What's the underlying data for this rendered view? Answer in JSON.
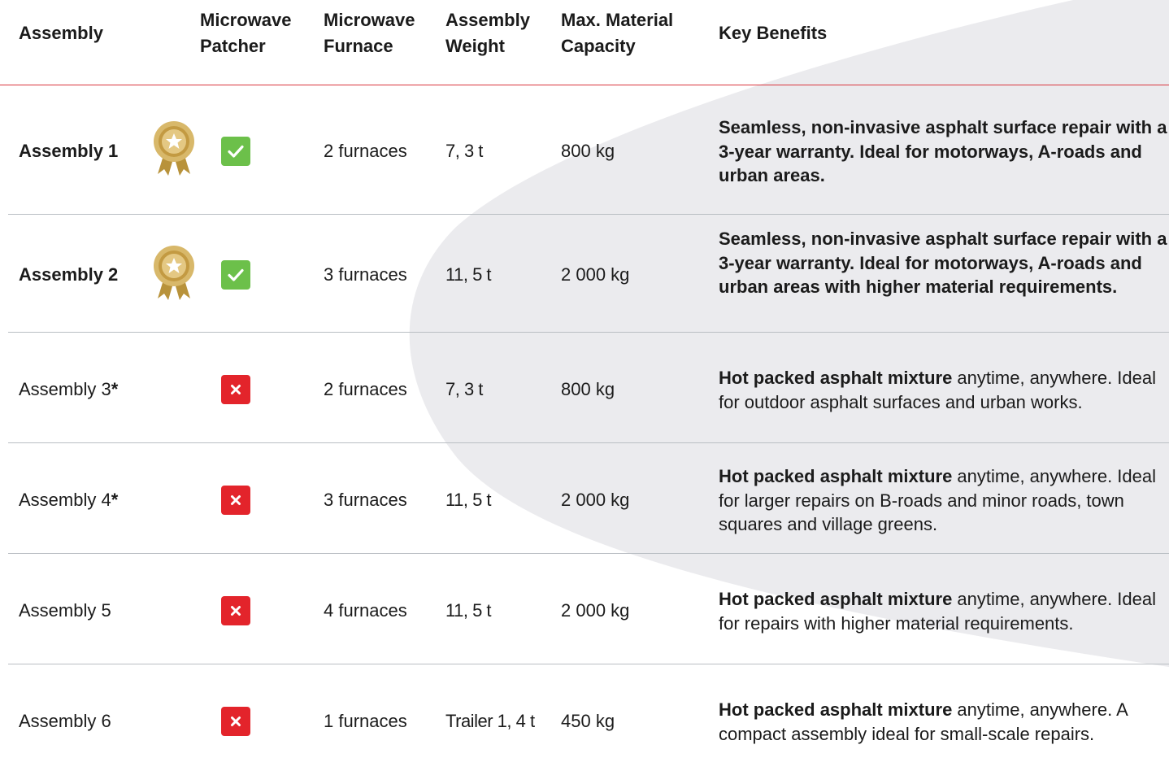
{
  "headers": {
    "assembly": "Assembly",
    "patcher": "Microwave Patcher",
    "furnace": "Microwave Furnace",
    "weight": "Assembly Weight",
    "capacity": "Max. Material Capacity",
    "benefits": "Key Benefits"
  },
  "rows": [
    {
      "name": "Assembly 1",
      "award": "award-medal-icon",
      "patcher": "check-icon",
      "furnaces": "2 furnaces",
      "weight": "7, 3 t",
      "capacity": "800 kg",
      "benefits_bold": "Seamless, non-invasive asphalt surface repair with a 3-year warranty. Ideal for motorways, A-roads and urban areas.",
      "benefits_rest": ""
    },
    {
      "name": "Assembly 2",
      "award": "award-medal-icon",
      "patcher": "check-icon",
      "furnaces": "3 furnaces",
      "weight": "11, 5 t",
      "capacity": "2 000 kg",
      "benefits_bold": "Seamless, non-invasive asphalt surface repair with a 3-year warranty. Ideal for motorways, A-roads and urban areas with higher material requirements.",
      "benefits_rest": ""
    },
    {
      "name": "Assembly 3",
      "name_mark": "*",
      "patcher": "cross-icon",
      "furnaces": "2 furnaces",
      "weight": "7, 3 t",
      "capacity": "800 kg",
      "benefits_bold": "Hot packed asphalt mixture",
      "benefits_rest": " anytime, anywhere. Ideal for outdoor asphalt surfaces and urban works."
    },
    {
      "name": "Assembly 4",
      "name_mark": "*",
      "patcher": "cross-icon",
      "furnaces": "3 furnaces",
      "weight": "11, 5 t",
      "capacity": "2 000 kg",
      "benefits_bold": "Hot packed asphalt mixture",
      "benefits_rest": " anytime, anywhere. Ideal for larger repairs on B-roads and minor roads, town squares and village greens."
    },
    {
      "name": "Assembly 5",
      "patcher": "cross-icon",
      "furnaces": "4 furnaces",
      "weight": "11, 5 t",
      "capacity": "2 000 kg",
      "benefits_bold": "Hot packed asphalt mixture",
      "benefits_rest": " anytime, anywhere. Ideal for repairs with higher material requirements."
    },
    {
      "name": "Assembly 6",
      "patcher": "cross-icon",
      "furnaces": "1 furnaces",
      "weight": "Trailer 1, 4 t",
      "capacity": "450 kg",
      "benefits_bold": "Hot packed asphalt mixture",
      "benefits_rest": " anytime, anywhere. A compact assembly ideal for small-scale repairs."
    }
  ],
  "colors": {
    "accent_line": "#d9363e",
    "check_green": "#6cc04a",
    "cross_red": "#e3242b",
    "medal_gold": "#c9a44a",
    "background_shape": "#ebebee"
  }
}
